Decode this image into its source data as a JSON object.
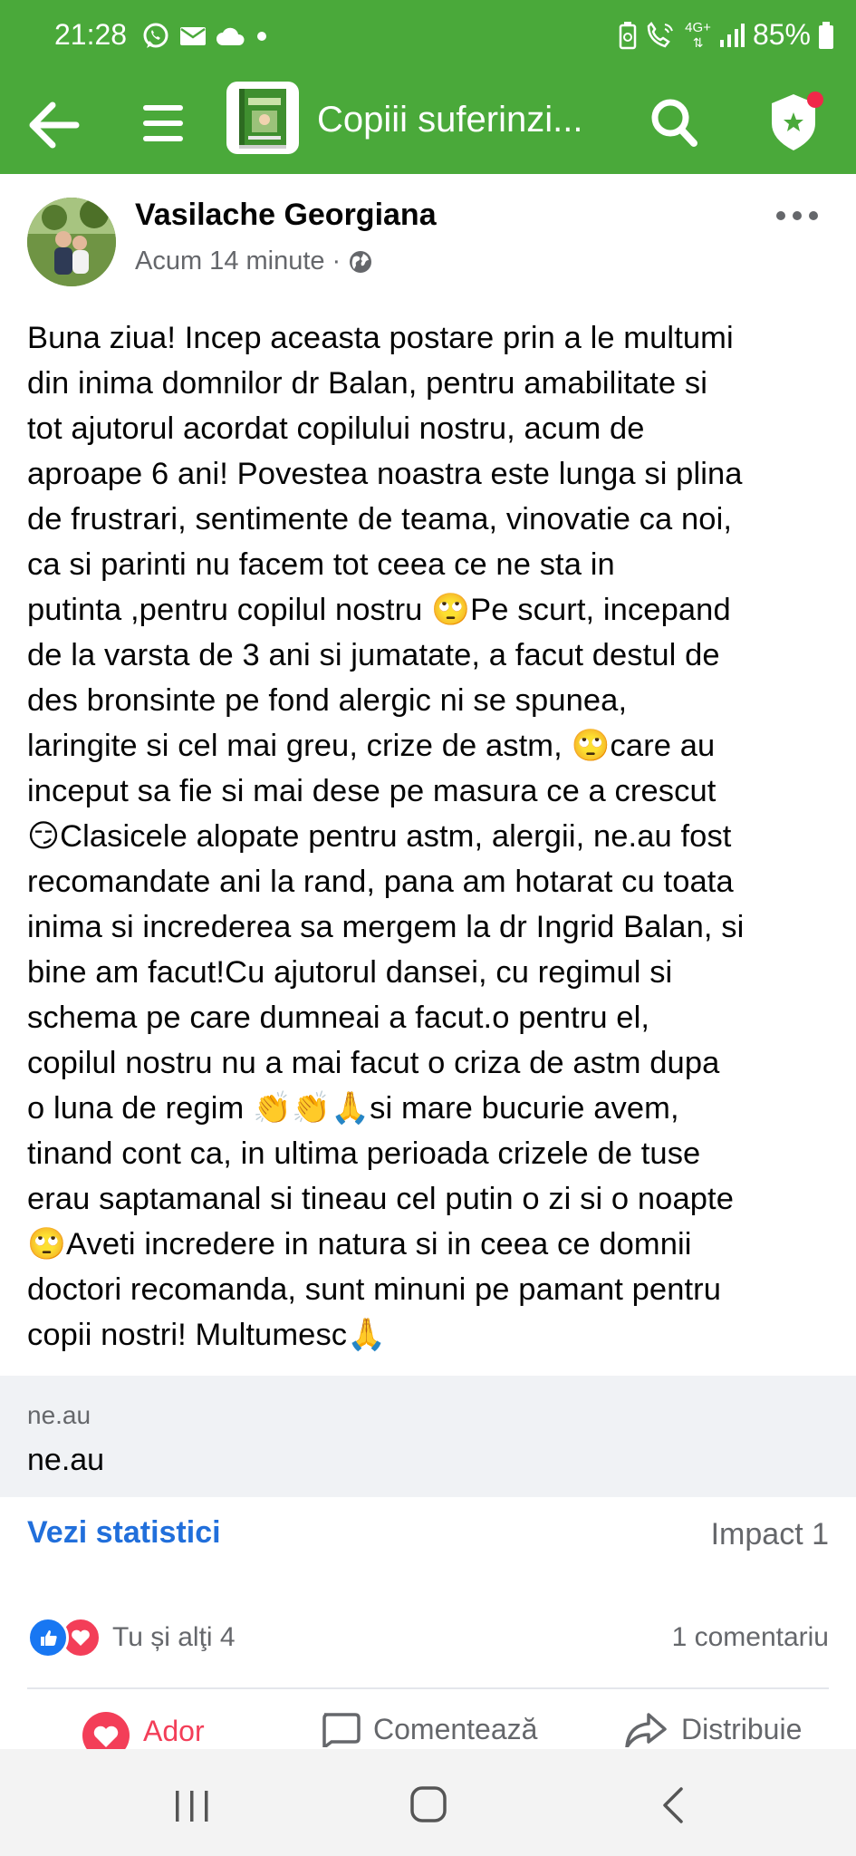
{
  "status_bar": {
    "time": "21:28",
    "network": "4G+",
    "battery": "85%",
    "left_icons": [
      "whatsapp-icon",
      "mail-icon",
      "cloud-icon",
      "dot-icon"
    ],
    "right_icons": [
      "battery-saver-icon",
      "wifi-calling-icon",
      "4g-plus-icon",
      "signal-icon",
      "battery-icon"
    ]
  },
  "app_bar": {
    "group_title": "Copiii suferinzi..."
  },
  "post": {
    "author": "Vasilache Georgiana",
    "time": "Acum 14 minute",
    "separator": "·",
    "privacy": "public",
    "body": "Buna ziua! Incep aceasta postare prin a le multumi\ndin inima domnilor dr Balan, pentru amabilitate si\ntot ajutorul acordat copilului nostru, acum de\naproape 6 ani! Povestea noastra este lunga si plina\nde frustrari, sentimente de teama, vinovatie ca noi,\nca si parinti nu facem tot ceea ce ne sta in\nputinta ,pentru copilul nostru 🙄Pe scurt, incepand\nde la varsta de 3 ani si jumatate, a facut destul de\ndes bronsinte pe fond alergic ni se spunea,\nlaringite si cel mai greu, crize de astm, 🙄care au\ninceput sa fie si mai dese pe masura ce a crescut\n😏Clasicele alopate pentru astm, alergii, ne.au fost\nrecomandate ani la rand, pana am hotarat cu toata\ninima si increderea sa mergem la dr Ingrid Balan, si\nbine am facut!Cu ajutorul dansei, cu regimul si\nschema pe care dumneai a facut.o pentru el,\ncopilul nostru nu a mai facut o criza de astm dupa\no luna de regim 👏👏🙏si mare bucurie avem,\ntinand cont ca, in ultima perioada crizele de tuse\nerau saptamanal si tineau cel putin o zi si o noapte\n🙄Aveti incredere in natura si in ceea ce domnii\ndoctori recomanda, sunt minuni pe pamant pentru\ncopii nostri! Multumesc🙏"
  },
  "link_preview": {
    "domain": "ne.au",
    "title": "ne.au"
  },
  "insights": {
    "label": "Vezi statistici",
    "impact": "Impact 1"
  },
  "reactions": {
    "summary": "Tu și alţi 4",
    "comments": "1 comentariu"
  },
  "actions": {
    "love": "Ador",
    "comment": "Comentează",
    "share": "Distribuie"
  },
  "colors": {
    "brand_green": "#4aa93a",
    "link_blue": "#216fdb",
    "love_red": "#f33e58",
    "like_blue": "#1877f2",
    "secondary_text": "#65676b"
  }
}
